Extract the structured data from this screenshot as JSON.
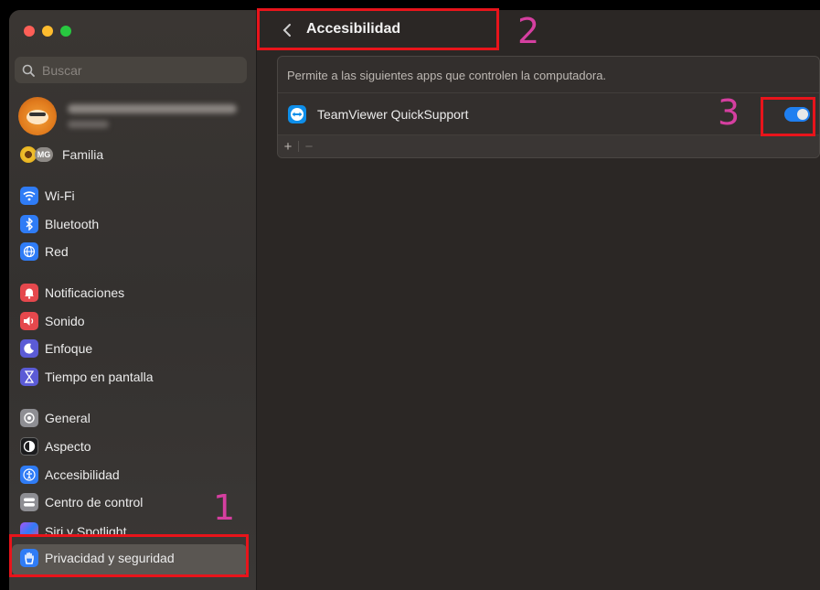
{
  "window": {
    "traffic_lights": [
      "close",
      "minimize",
      "zoom"
    ]
  },
  "sidebar": {
    "search_placeholder": "Buscar",
    "account": {
      "name": "",
      "subtitle": ""
    },
    "family": {
      "badge": "MG",
      "label": "Familia"
    },
    "items": [
      {
        "label": "Wi-Fi",
        "icon": "wifi-icon",
        "color": "#2f7cf6"
      },
      {
        "label": "Bluetooth",
        "icon": "bluetooth-icon",
        "color": "#2f7cf6"
      },
      {
        "label": "Red",
        "icon": "globe-icon",
        "color": "#2f7cf6"
      },
      {
        "label": "Notificaciones",
        "icon": "bell-icon",
        "color": "#e5484d"
      },
      {
        "label": "Sonido",
        "icon": "speaker-icon",
        "color": "#e5484d"
      },
      {
        "label": "Enfoque",
        "icon": "moon-icon",
        "color": "#5b5bd6"
      },
      {
        "label": "Tiempo en pantalla",
        "icon": "hourglass-icon",
        "color": "#5b5bd6"
      },
      {
        "label": "General",
        "icon": "gear-icon",
        "color": "#8e8e93"
      },
      {
        "label": "Aspecto",
        "icon": "appearance-icon",
        "color": "#1c1c1e"
      },
      {
        "label": "Accesibilidad",
        "icon": "accessibility-icon",
        "color": "#2f7cf6"
      },
      {
        "label": "Centro de control",
        "icon": "control-center-icon",
        "color": "#8e8e93"
      },
      {
        "label": "Siri y Spotlight",
        "icon": "siri-icon",
        "color": "#a855f7"
      },
      {
        "label": "Privacidad y seguridad",
        "icon": "hand-icon",
        "color": "#2f7cf6",
        "selected": true
      }
    ]
  },
  "main": {
    "back_label": "‹",
    "title": "Accesibilidad",
    "description": "Permite a las siguientes apps que controlen la computadora.",
    "apps": [
      {
        "name": "TeamViewer QuickSupport",
        "enabled": true
      }
    ],
    "add_label": "+",
    "remove_label": "−"
  },
  "annotations": [
    "1",
    "2",
    "3"
  ]
}
